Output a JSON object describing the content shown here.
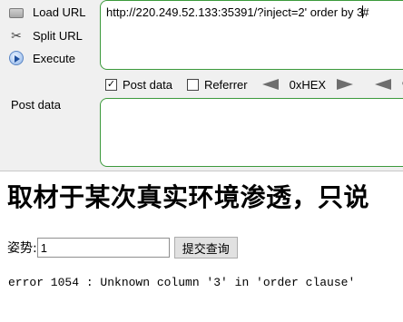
{
  "hackbar": {
    "menu": {
      "load_url": "Load URL",
      "split_url": "Split URL",
      "execute": "Execute"
    },
    "url_value": "http://220.249.52.133:35391/?inject=2' order by 3",
    "url_value_tail": "#",
    "options": {
      "post_data": {
        "label": "Post data",
        "checked": true
      },
      "referrer": {
        "label": "Referrer",
        "checked": false
      },
      "hex_label": "0xHEX",
      "next_label": "%"
    },
    "post_data_label": "Post data",
    "post_data_value": ""
  },
  "page": {
    "title": "取材于某次真实环境渗透，只说",
    "form": {
      "label": "姿势:",
      "input_value": "1",
      "submit_label": "提交查询"
    },
    "error_message": "error 1054 : Unknown column '3' in 'order clause'"
  }
}
